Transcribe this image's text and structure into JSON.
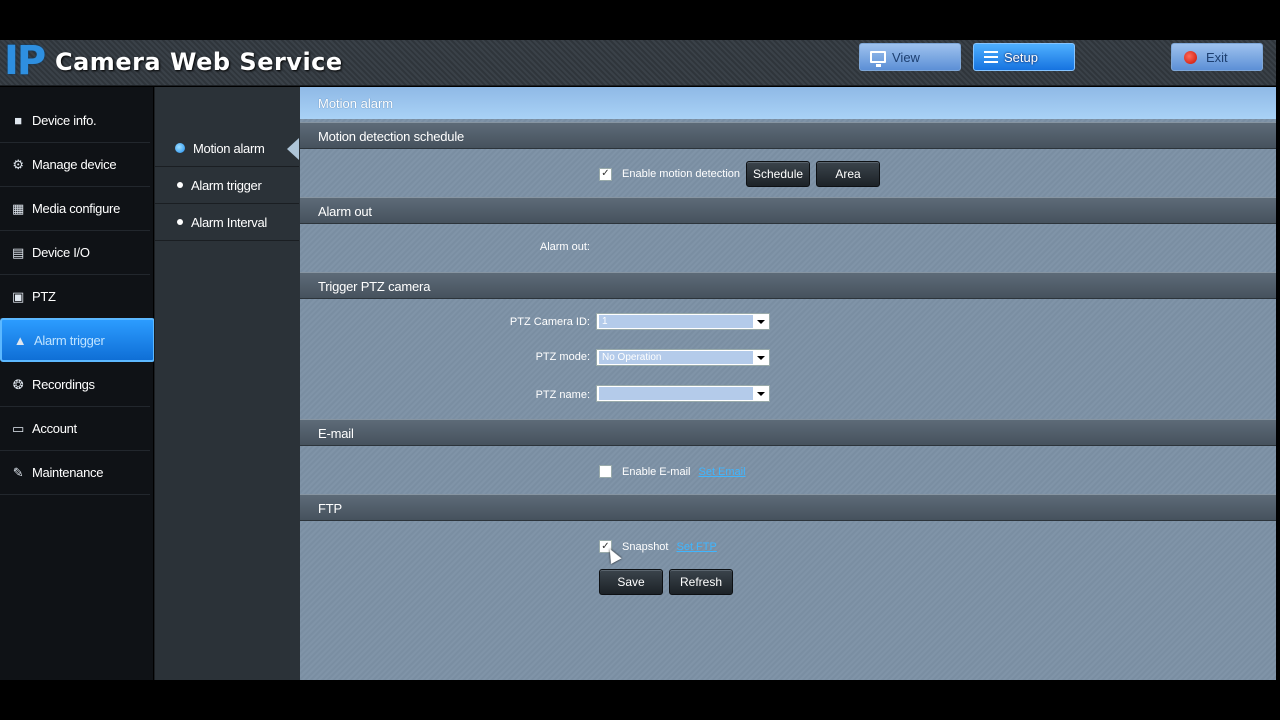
{
  "header": {
    "logo_mark": "IP",
    "title": "Camera Web Service",
    "buttons": {
      "view": "View",
      "setup": "Setup",
      "exit": "Exit"
    }
  },
  "leftnav": {
    "items": [
      {
        "label": "Device info.",
        "icon": "camera-icon"
      },
      {
        "label": "Manage device",
        "icon": "gear-icon"
      },
      {
        "label": "Media configure",
        "icon": "film-icon"
      },
      {
        "label": "Device I/O",
        "icon": "io-port-icon"
      },
      {
        "label": "PTZ",
        "icon": "ptz-icon"
      },
      {
        "label": "Alarm trigger",
        "icon": "alarm-bell-icon",
        "active": true
      },
      {
        "label": "Recordings",
        "icon": "reel-icon"
      },
      {
        "label": "Account",
        "icon": "monitor-icon"
      },
      {
        "label": "Maintenance",
        "icon": "wrench-icon"
      }
    ]
  },
  "subnav": {
    "items": [
      {
        "label": "Motion alarm",
        "active": true
      },
      {
        "label": "Alarm trigger"
      },
      {
        "label": "Alarm Interval"
      }
    ]
  },
  "main": {
    "title": "Motion alarm",
    "sections": {
      "motion": {
        "heading": "Motion detection schedule",
        "enable_label": "Enable motion detection",
        "enable_checked": true,
        "schedule_button": "Schedule",
        "area_button": "Area"
      },
      "alarm_out": {
        "heading": "Alarm out",
        "label": "Alarm out:"
      },
      "ptz": {
        "heading": "Trigger PTZ camera",
        "camera_id_label": "PTZ Camera ID:",
        "camera_id_value": "1",
        "mode_label": "PTZ mode:",
        "mode_value": "No Operation",
        "name_label": "PTZ name:",
        "name_value": ""
      },
      "email": {
        "heading": "E-mail",
        "enable_label": "Enable E-mail",
        "enable_checked": false,
        "link": "Set Email"
      },
      "ftp": {
        "heading": "FTP",
        "snapshot_label": "Snapshot",
        "snapshot_checked": true,
        "link": "Set FTP"
      }
    },
    "save_button": "Save",
    "refresh_button": "Refresh"
  }
}
